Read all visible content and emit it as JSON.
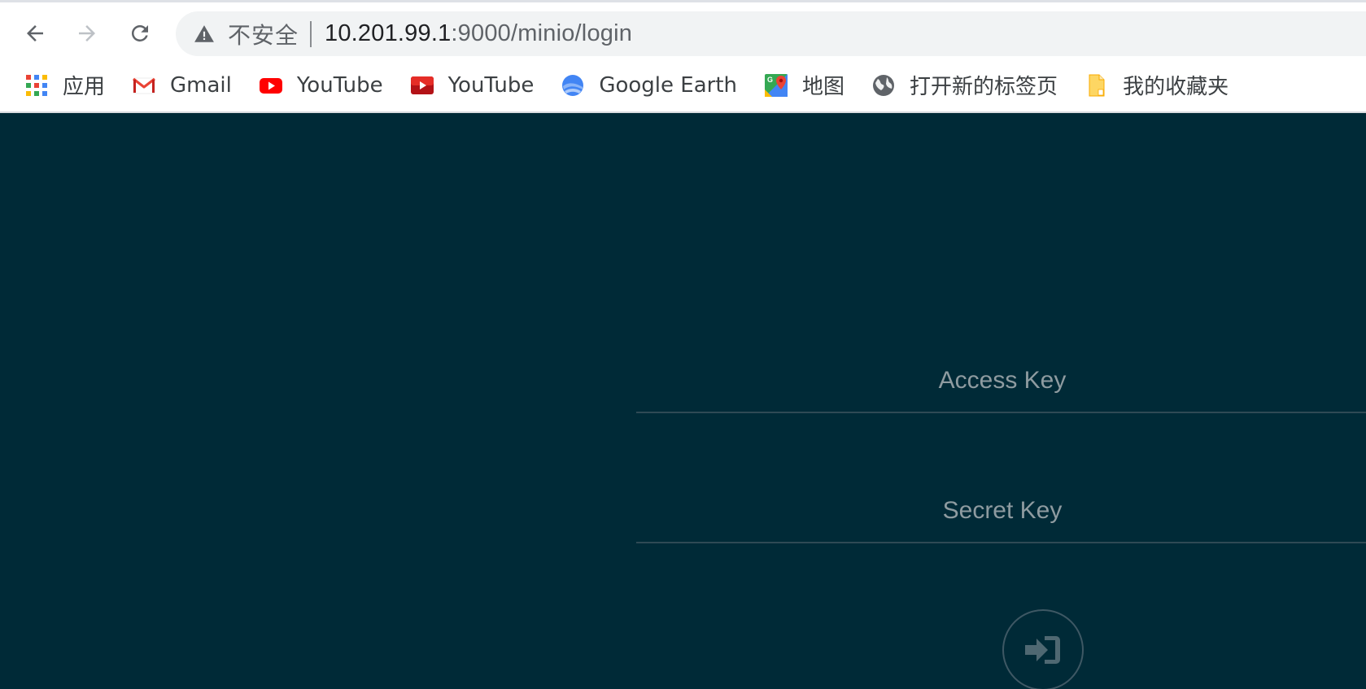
{
  "browser": {
    "omnibox": {
      "security_label": "不安全",
      "url_host": "10.201.99.1",
      "url_path": ":9000/minio/login"
    },
    "bookmarks": [
      {
        "label": "应用",
        "icon": "apps-grid-icon"
      },
      {
        "label": "Gmail",
        "icon": "gmail-icon"
      },
      {
        "label": "YouTube",
        "icon": "youtube-icon"
      },
      {
        "label": "YouTube",
        "icon": "youtube-icon"
      },
      {
        "label": "Google Earth",
        "icon": "google-earth-icon"
      },
      {
        "label": "地图",
        "icon": "google-maps-icon"
      },
      {
        "label": "打开新的标签页",
        "icon": "globe-icon"
      },
      {
        "label": "我的收藏夹",
        "icon": "folder-icon"
      }
    ]
  },
  "login": {
    "access_key_placeholder": "Access Key",
    "secret_key_placeholder": "Secret Key",
    "submit_icon": "sign-in-icon"
  },
  "colors": {
    "page_background": "#002a37",
    "input_underline": "#2f4a55",
    "placeholder": "#8e9ba0"
  }
}
